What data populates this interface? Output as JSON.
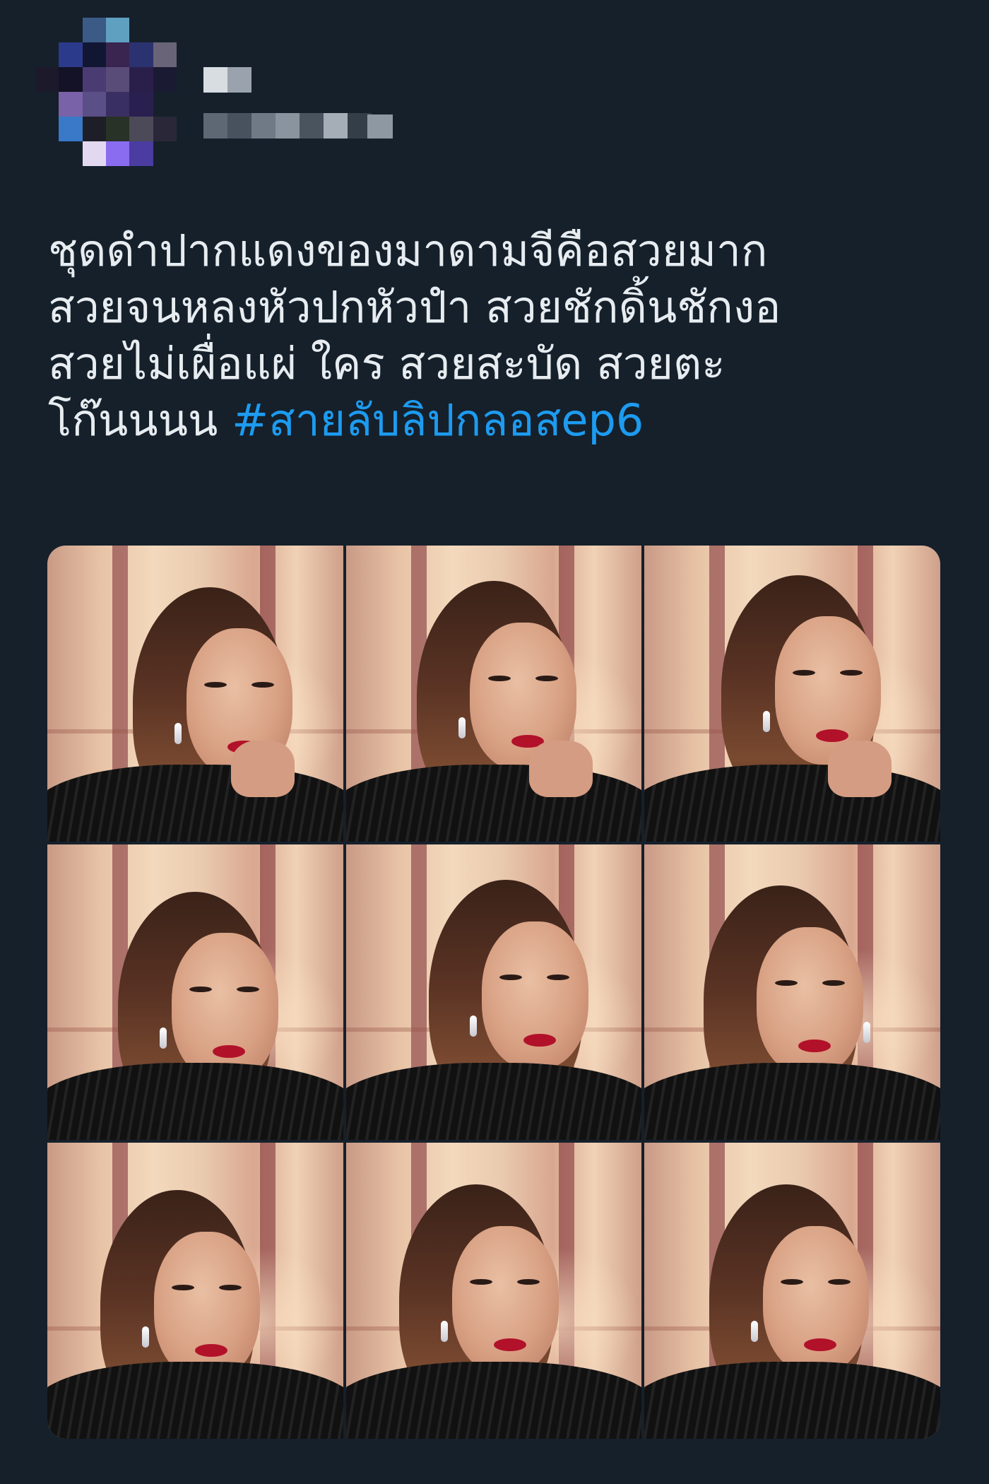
{
  "tweet": {
    "author": {
      "avatar_icon": "pixelated-avatar-icon",
      "name_censored": true,
      "handle_censored": true
    },
    "text_lines": [
      "ชุดดำปากแดงของมาดามจีคือสวยมาก",
      "สวยจนหลงหัวปกหัวปำ สวยชักดิ้นชักงอ",
      "สวยไม่เผื่อแผ่ ใคร สวยสะบัด สวยตะ",
      "โก๊นนนน"
    ],
    "hashtag": "#สายลับลิปกลอสep6",
    "colors": {
      "background": "#15202b",
      "text": "#e7ecf0",
      "link": "#1d9bf0"
    },
    "media": {
      "layout": "3x3 grid",
      "photo_icon": "woman-portrait-photo"
    }
  }
}
